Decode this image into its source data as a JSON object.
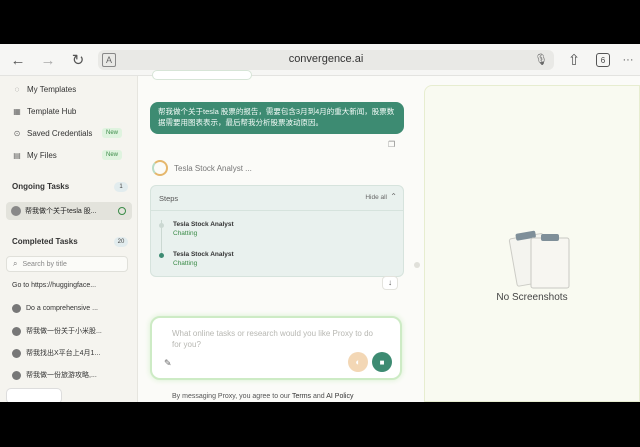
{
  "browser": {
    "url": "convergence.ai",
    "tab_count": "6",
    "back_icon": "←",
    "forward_icon": "→",
    "reload_icon": "↻",
    "share_icon": "⇧",
    "more_icon": "···"
  },
  "sidebar": {
    "nav": [
      {
        "label": "My Templates",
        "icon": "◌"
      },
      {
        "label": "Template Hub",
        "icon": "▦"
      },
      {
        "label": "Saved Credentials",
        "icon": "⊙",
        "badge": "New"
      },
      {
        "label": "My Files",
        "icon": "▤",
        "badge": "New"
      }
    ],
    "ongoing": {
      "title": "Ongoing Tasks",
      "count": "1",
      "task": "帮我做个关于tesla 股..."
    },
    "completed": {
      "title": "Completed Tasks",
      "count": "20",
      "search_placeholder": "Search by title",
      "tasks": [
        "Go to https://huggingface...",
        "Do a comprehensive ...",
        "帮我做一份关于小米股...",
        "帮我找出X平台上4月1...",
        "帮我做一份旅游攻略,..."
      ]
    }
  },
  "chat": {
    "user_message": "帮我做个关于tesla 股票的报告，需要包含3月到4月的重大新闻，股票数据需要用图表表示，最后帮我分析股票波动原因。",
    "agent_name": "Tesla Stock Analyst ...",
    "steps": {
      "title": "Steps",
      "hide_label": "Hide all",
      "items": [
        {
          "name": "Tesla Stock Analyst",
          "status": "Chatting"
        },
        {
          "name": "Tesla Stock Analyst",
          "status": "Chatting"
        }
      ]
    },
    "input_placeholder": "What online tasks or research would you like Proxy to do for you?",
    "disclaimer_prefix": "By messaging Proxy, you agree to our",
    "terms_label": "Terms",
    "and_label": "and",
    "policy_label": "AI Policy"
  },
  "screenshots": {
    "empty_label": "No Screenshots"
  },
  "colors": {
    "accent": "#3d8b72",
    "new_badge": "#dff3df",
    "panel_bg": "#f9faf1"
  }
}
